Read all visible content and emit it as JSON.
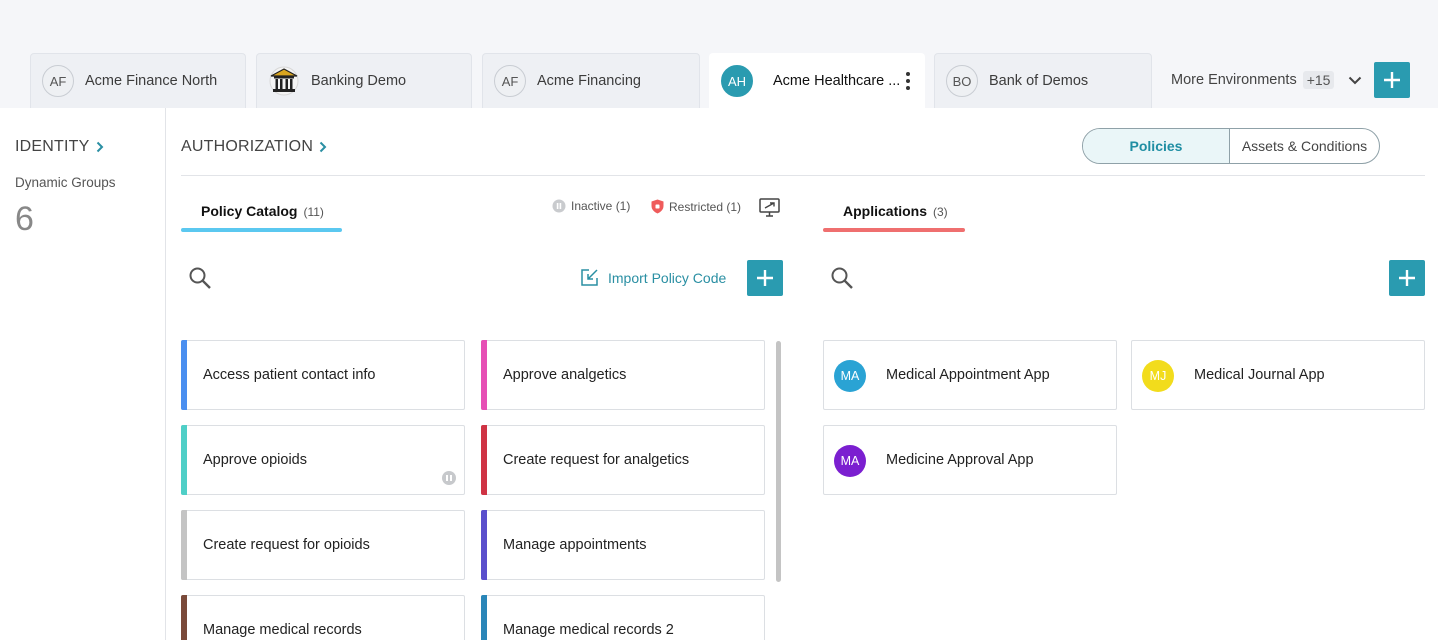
{
  "environments": {
    "tabs": [
      {
        "initials": "AF",
        "name": "Acme Finance North"
      },
      {
        "initials": "",
        "name": "Banking Demo"
      },
      {
        "initials": "AF",
        "name": "Acme Financing"
      },
      {
        "initials": "AH",
        "name": "Acme Healthcare ..."
      },
      {
        "initials": "BO",
        "name": "Bank of Demos"
      }
    ],
    "more_label": "More Environments",
    "more_count": "+15"
  },
  "identity": {
    "title": "IDENTITY",
    "dynamic_groups_label": "Dynamic Groups",
    "dynamic_groups_count": "6"
  },
  "authorization": {
    "title": "AUTHORIZATION",
    "segments": {
      "policies": "Policies",
      "assets": "Assets & Conditions"
    },
    "policy_catalog": {
      "label": "Policy Catalog",
      "count": "(11)",
      "legend_inactive": "Inactive (1)",
      "legend_restricted": "Restricted (1)",
      "import_label": "Import Policy Code",
      "policies": [
        {
          "name": "Access patient contact info",
          "color": "#4a8ff0"
        },
        {
          "name": "Approve analgetics",
          "color": "#e64fb5"
        },
        {
          "name": "Approve opioids",
          "color": "#4fcfc7"
        },
        {
          "name": "Create request for analgetics",
          "color": "#cf3344"
        },
        {
          "name": "Create request for opioids",
          "color": "#c4c4c4"
        },
        {
          "name": "Manage appointments",
          "color": "#5a4fcc"
        },
        {
          "name": "Manage medical records",
          "color": "#7a4a3a"
        },
        {
          "name": "Manage medical records 2",
          "color": "#2a86b8"
        }
      ]
    },
    "applications": {
      "label": "Applications",
      "count": "(3)",
      "apps": [
        {
          "initials": "MA",
          "name": "Medical Appointment App",
          "color": "#2aa3d4"
        },
        {
          "initials": "MJ",
          "name": "Medical Journal App",
          "color": "#f2dc1c"
        },
        {
          "initials": "MA",
          "name": "Medicine Approval App",
          "color": "#7b1fd0"
        }
      ]
    }
  },
  "colors": {
    "accent": "#2a9bb0",
    "policy_tab_underline": "#5bc8f0",
    "apps_tab_underline": "#ef6f6f"
  },
  "icons": [
    "bank-icon",
    "kebab-menu-icon",
    "chevron-down-icon",
    "plus-icon",
    "chevron-right-icon",
    "pause-icon",
    "shield-icon",
    "monitor-icon",
    "search-icon",
    "import-icon"
  ]
}
